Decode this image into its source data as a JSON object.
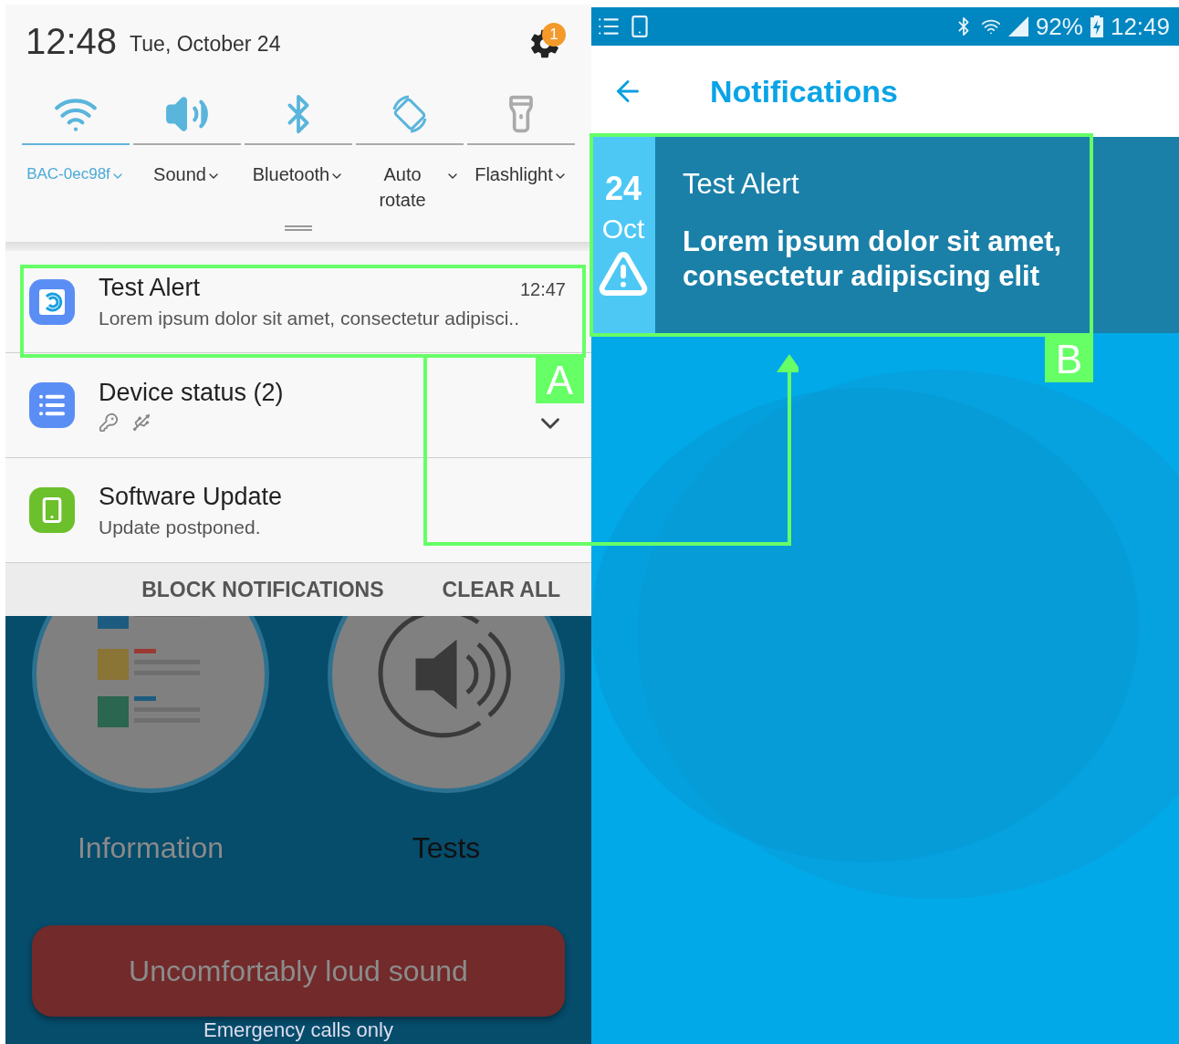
{
  "left_screen": {
    "header": {
      "time": "12:48",
      "date": "Tue, October 24",
      "settings_badge": "1"
    },
    "quick_toggles": [
      {
        "kind": "wifi",
        "label": "BAC-0ec98f",
        "on": true,
        "connected": true
      },
      {
        "kind": "sound",
        "label": "Sound",
        "on": true,
        "connected": false
      },
      {
        "kind": "bluetooth",
        "label": "Bluetooth",
        "on": true,
        "connected": false
      },
      {
        "kind": "rotate",
        "label": "Auto rotate",
        "on": true,
        "connected": false
      },
      {
        "kind": "flashlight",
        "label": "Flashlight",
        "on": false,
        "connected": false
      }
    ],
    "notifications": [
      {
        "kind": "alert",
        "title": "Test Alert",
        "time": "12:47",
        "text": "Lorem ipsum dolor sit amet, consectetur adipisci.."
      },
      {
        "kind": "device",
        "title": "Device status (2)"
      },
      {
        "kind": "update",
        "title": "Software Update",
        "text": "Update postponed."
      }
    ],
    "actions": [
      "BLOCK NOTIFICATIONS",
      "CLEAR ALL"
    ],
    "background_app": {
      "tiles": [
        {
          "kind": "info",
          "label": "Information"
        },
        {
          "kind": "tests",
          "label": "Tests"
        }
      ],
      "alarm_button": "Uncomfortably loud sound",
      "carrier_text": "Emergency calls only"
    }
  },
  "right_screen": {
    "status_bar": {
      "battery": "92%",
      "time": "12:49"
    },
    "title": "Notifications",
    "alert": {
      "day": "24",
      "month": "Oct",
      "title": "Test Alert",
      "message": "Lorem ipsum dolor sit amet, consectetur adipiscing elit"
    }
  },
  "callouts": [
    {
      "label": "A"
    },
    {
      "label": "B"
    }
  ]
}
